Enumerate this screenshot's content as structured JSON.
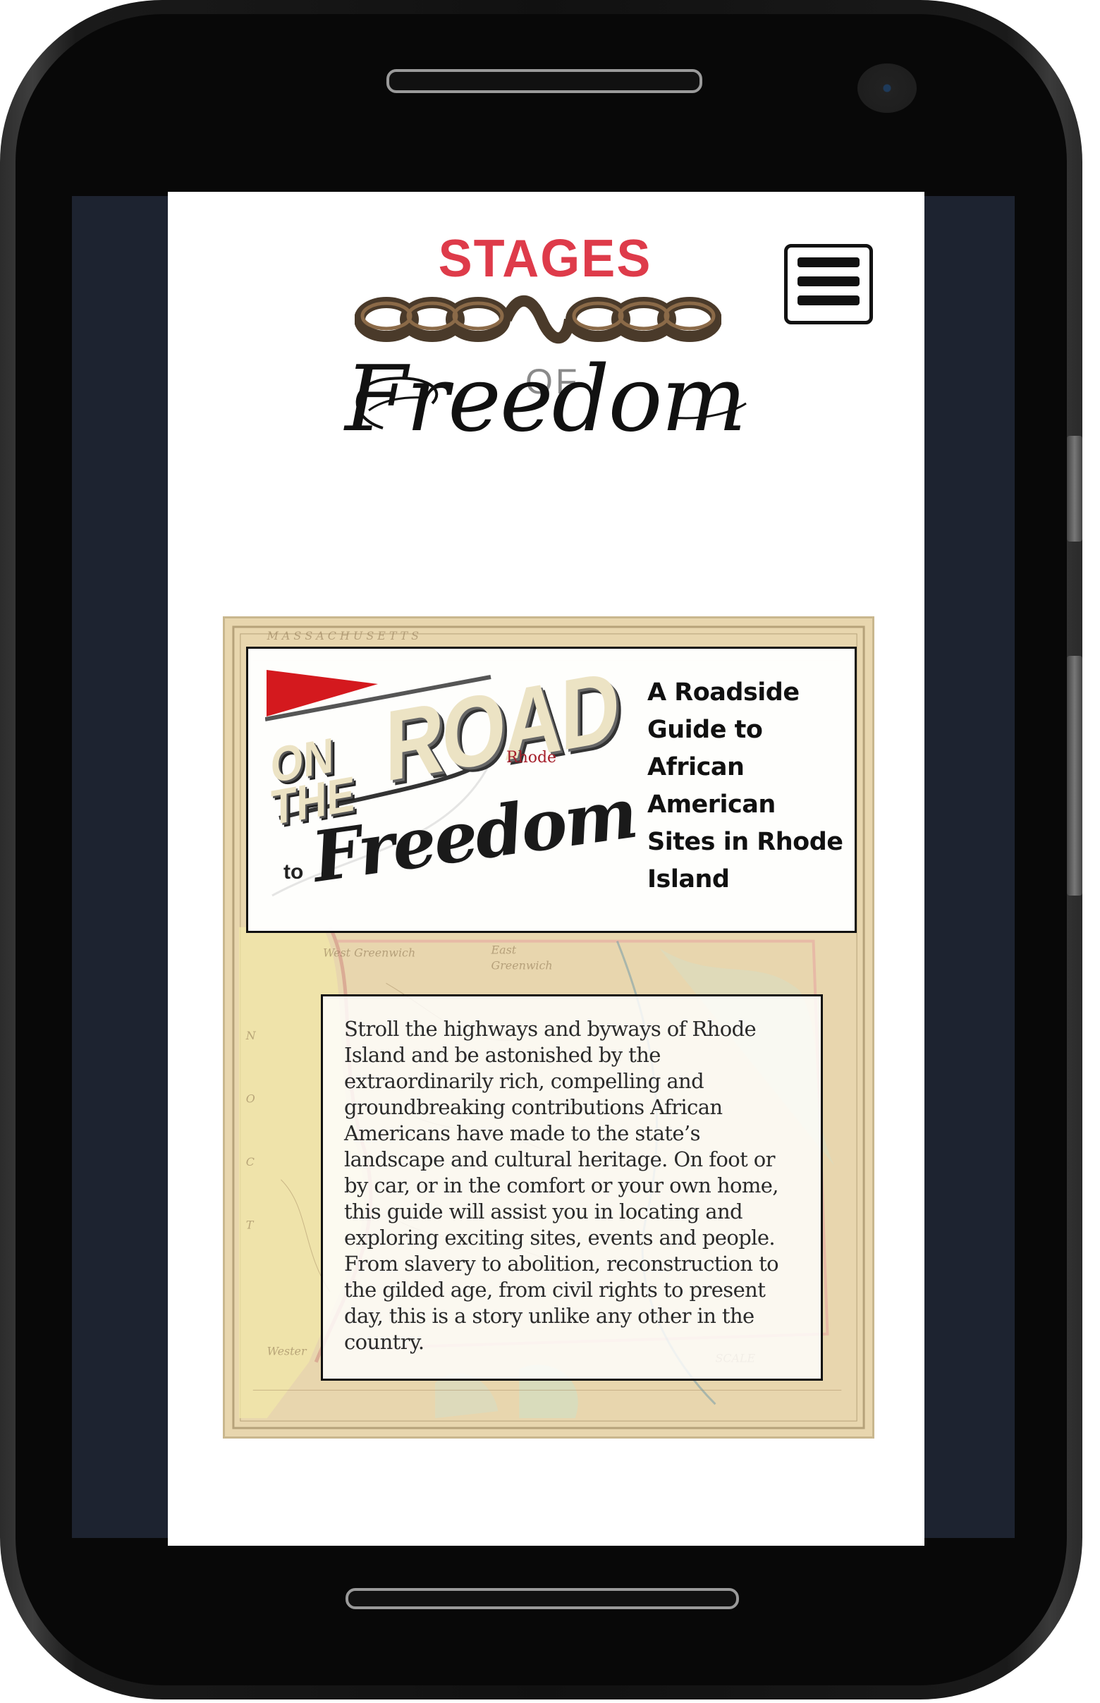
{
  "header": {
    "logo_top": "STAGES",
    "logo_of": "OF",
    "logo_main": "Freedom"
  },
  "menu": {
    "icon": "hamburger-menu-icon"
  },
  "hero": {
    "road_art": {
      "on": "ON",
      "the": "THE",
      "road": "ROAD",
      "rhode": "Rhode",
      "to": "to",
      "freedom": "Freedom"
    },
    "guide_title": "A Roadside Guide to African American Sites in Rhode Island",
    "description": "Stroll the highways and byways of Rhode Island and be astonished by the extraordinarily rich, compelling and groundbreaking contributions African Americans have made to the state’s landscape and cultural heritage. On foot or by car, or in the comfort or your own home, this guide will assist you in locating and exploring exciting sites, events and people. From slavery to abolition, reconstruction to the gilded age, from civil rights to present day, this is a story unlike any other in the country."
  },
  "colors": {
    "stages_red": "#de3b4a",
    "screen_bg": "#1d2330",
    "map_parchment": "#ead9b4",
    "pennant_red": "#d4191e"
  }
}
